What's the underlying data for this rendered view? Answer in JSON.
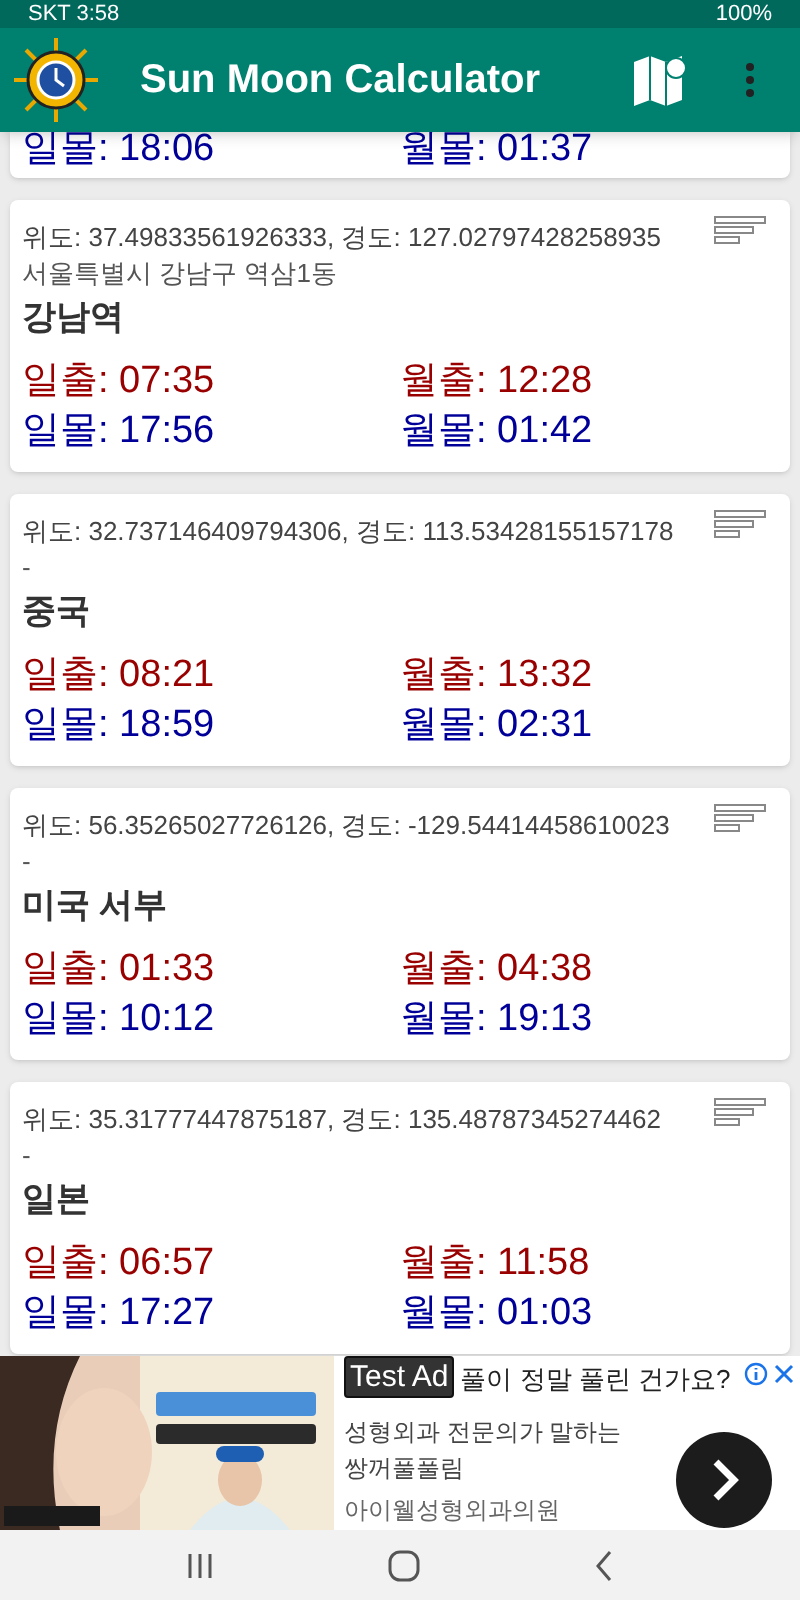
{
  "status_bar": {
    "carrier_time": "SKT 3:58",
    "battery": "100%"
  },
  "app_bar": {
    "title": "Sun Moon Calculator"
  },
  "partial_card": {
    "sunset": "일몰: 18:06",
    "moonset": "월몰: 01:37"
  },
  "cards": [
    {
      "coords": "위도: 37.49833561926333, 경도: 127.02797428258935",
      "address": "서울특별시 강남구 역삼1동",
      "name": "강남역",
      "sunrise": "일출: 07:35",
      "moonrise": "월출: 12:28",
      "sunset": "일몰: 17:56",
      "moonset": "월몰: 01:42"
    },
    {
      "coords": "위도: 32.737146409794306, 경도: 113.53428155157178",
      "address": "-",
      "name": "중국",
      "sunrise": "일출: 08:21",
      "moonrise": "월출: 13:32",
      "sunset": "일몰: 18:59",
      "moonset": "월몰: 02:31"
    },
    {
      "coords": "위도: 56.35265027726126, 경도: -129.54414458610023",
      "address": "-",
      "name": "미국 서부",
      "sunrise": "일출: 01:33",
      "moonrise": "월출: 04:38",
      "sunset": "일몰: 10:12",
      "moonset": "월몰: 19:13"
    },
    {
      "coords": "위도: 35.31777447875187, 경도: 135.48787345274462",
      "address": "-",
      "name": "일본",
      "sunrise": "일출: 06:57",
      "moonrise": "월출: 11:58",
      "sunset": "일몰: 17:27",
      "moonset": "월몰: 01:03"
    }
  ],
  "ad": {
    "kind": "picture",
    "label": "Test Ad",
    "headline": "풀이 정말 풀린 건가요?",
    "lines": [
      "성형외과 전문의가 말하는",
      "쌍꺼풀풀림",
      "아이웰성형외과의원"
    ]
  }
}
